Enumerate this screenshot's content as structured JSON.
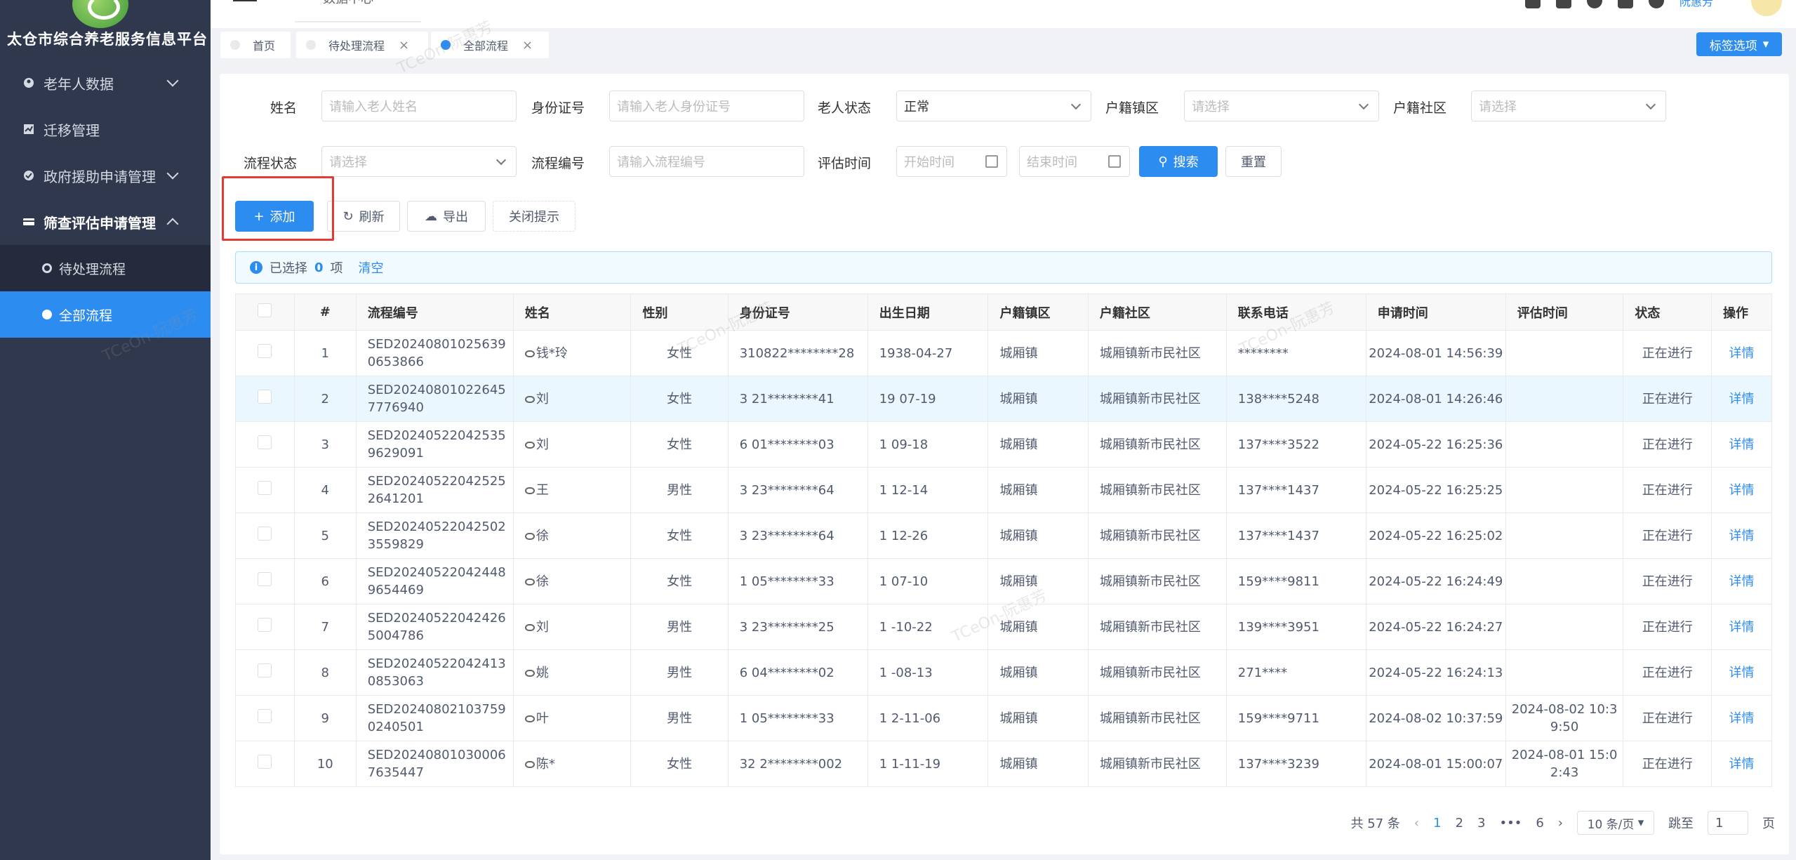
{
  "sidebar": {
    "app_title": "太仓市综合养老服务信息平台",
    "items": [
      {
        "label": "老年人数据"
      },
      {
        "label": "迁移管理"
      },
      {
        "label": "政府援助申请管理"
      },
      {
        "label": "筛查评估申请管理"
      }
    ],
    "sub_items": [
      {
        "label": "待处理流程"
      },
      {
        "label": "全部流程"
      }
    ]
  },
  "topbar": {
    "crumb": "数据中心",
    "user": "阮惠芳"
  },
  "tags": [
    {
      "label": "首页"
    },
    {
      "label": "待处理流程"
    },
    {
      "label": "全部流程"
    }
  ],
  "tag_options": "标签选项",
  "filters": {
    "name_label": "姓名",
    "name_placeholder": "请输入老人姓名",
    "id_label": "身份证号",
    "id_placeholder": "请输入老人身份证号",
    "status_label": "老人状态",
    "status_value": "正常",
    "town_label": "户籍镇区",
    "town_placeholder": "请选择",
    "community_label": "户籍社区",
    "community_placeholder": "请选择",
    "flow_status_label": "流程状态",
    "flow_status_placeholder": "请选择",
    "flow_no_label": "流程编号",
    "flow_no_placeholder": "请输入流程编号",
    "eval_time_label": "评估时间",
    "start_placeholder": "开始时间",
    "end_placeholder": "结束时间",
    "search": "搜索",
    "reset": "重置"
  },
  "toolbar": {
    "add": "添加",
    "refresh": "刷新",
    "export": "导出",
    "close_tip": "关闭提示"
  },
  "selection": {
    "prefix": "已选择",
    "count": "0",
    "suffix": "项",
    "clear": "清空"
  },
  "table": {
    "headers": [
      "#",
      "流程编号",
      "姓名",
      "性别",
      "身份证号",
      "出生日期",
      "户籍镇区",
      "户籍社区",
      "联系电话",
      "申请时间",
      "评估时间",
      "状态",
      "操作"
    ],
    "rows": [
      {
        "no": "1",
        "flow": "SED202408010256390653866",
        "name": "钱*玲",
        "gender": "女性",
        "id": "310822********28",
        "birth": "1938-04-27",
        "town": "城厢镇",
        "community": "城厢镇新市民社区",
        "phone": "********",
        "apply": "2024-08-01 14:56:39",
        "eval": "",
        "status": "正在进行",
        "op": "详情"
      },
      {
        "no": "2",
        "flow": "SED202408010226457776940",
        "name": "刘",
        "gender": "女性",
        "id": "3 21********41",
        "birth": "19 07-19",
        "town": "城厢镇",
        "community": "城厢镇新市民社区",
        "phone": "138****5248",
        "apply": "2024-08-01 14:26:46",
        "eval": "",
        "status": "正在进行",
        "op": "详情"
      },
      {
        "no": "3",
        "flow": "SED202405220425359629091",
        "name": "刘",
        "gender": "女性",
        "id": "6 01********03",
        "birth": "1 09-18",
        "town": "城厢镇",
        "community": "城厢镇新市民社区",
        "phone": "137****3522",
        "apply": "2024-05-22 16:25:36",
        "eval": "",
        "status": "正在进行",
        "op": "详情"
      },
      {
        "no": "4",
        "flow": "SED202405220425252641201",
        "name": "王",
        "gender": "男性",
        "id": "3 23********64",
        "birth": "1 12-14",
        "town": "城厢镇",
        "community": "城厢镇新市民社区",
        "phone": "137****1437",
        "apply": "2024-05-22 16:25:25",
        "eval": "",
        "status": "正在进行",
        "op": "详情"
      },
      {
        "no": "5",
        "flow": "SED202405220425023559829",
        "name": "徐",
        "gender": "女性",
        "id": "3 23********64",
        "birth": "1 12-26",
        "town": "城厢镇",
        "community": "城厢镇新市民社区",
        "phone": "137****1437",
        "apply": "2024-05-22 16:25:02",
        "eval": "",
        "status": "正在进行",
        "op": "详情"
      },
      {
        "no": "6",
        "flow": "SED202405220424489654469",
        "name": "徐",
        "gender": "女性",
        "id": "1 05********33",
        "birth": "1 07-10",
        "town": "城厢镇",
        "community": "城厢镇新市民社区",
        "phone": "159****9811",
        "apply": "2024-05-22 16:24:49",
        "eval": "",
        "status": "正在进行",
        "op": "详情"
      },
      {
        "no": "7",
        "flow": "SED202405220424265004786",
        "name": "刘",
        "gender": "男性",
        "id": "3 23********25",
        "birth": "1 -10-22",
        "town": "城厢镇",
        "community": "城厢镇新市民社区",
        "phone": "139****3951",
        "apply": "2024-05-22 16:24:27",
        "eval": "",
        "status": "正在进行",
        "op": "详情"
      },
      {
        "no": "8",
        "flow": "SED202405220424130853063",
        "name": "姚",
        "gender": "男性",
        "id": "6 04********02",
        "birth": "1 -08-13",
        "town": "城厢镇",
        "community": "城厢镇新市民社区",
        "phone": "271****",
        "apply": "2024-05-22 16:24:13",
        "eval": "",
        "status": "正在进行",
        "op": "详情"
      },
      {
        "no": "9",
        "flow": "SED202408021037590240501",
        "name": "叶",
        "gender": "男性",
        "id": "1 05********33",
        "birth": "1 2-11-06",
        "town": "城厢镇",
        "community": "城厢镇新市民社区",
        "phone": "159****9711",
        "apply": "2024-08-02 10:37:59",
        "eval": "2024-08-02 10:39:50",
        "status": "正在进行",
        "op": "详情"
      },
      {
        "no": "10",
        "flow": "SED202408010300067635447",
        "name": "陈*",
        "gender": "女性",
        "id": "32 2********002",
        "birth": "1 1-11-19",
        "town": "城厢镇",
        "community": "城厢镇新市民社区",
        "phone": "137****3239",
        "apply": "2024-08-01 15:00:07",
        "eval": "2024-08-01 15:02:43",
        "status": "正在进行",
        "op": "详情"
      }
    ]
  },
  "pager": {
    "total": "共 57 条",
    "pages": [
      "1",
      "2",
      "3",
      "•••",
      "6"
    ],
    "size": "10 条/页",
    "jump_label": "跳至",
    "jump_value": "1",
    "page_suffix": "页"
  },
  "watermark": "TCeOn-阮惠芳"
}
